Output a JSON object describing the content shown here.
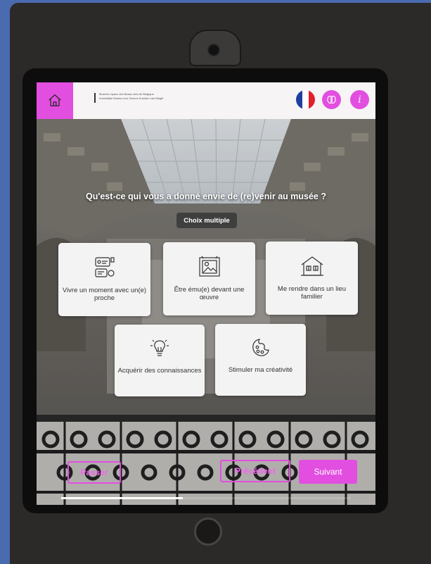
{
  "header": {
    "logo_line1": "Musées royaux des Beaux-Arts de Belgique",
    "logo_line2": "Koninklijke Musea voor Schone Kunsten van België"
  },
  "question": "Qu'est-ce qui vous a donné envie de (re)venir au musée ?",
  "badge": "Choix multiple",
  "options": [
    {
      "label": "Vivre un moment avec un(e) proche",
      "icon": "chat-bubbles-icon"
    },
    {
      "label": "Être ému(e) devant une œuvre",
      "icon": "framed-painting-icon"
    },
    {
      "label": "Me rendre dans un lieu familier",
      "icon": "house-icon"
    },
    {
      "label": "Acquérir des connaissances",
      "icon": "lightbulb-icon"
    },
    {
      "label": "Stimuler ma créativité",
      "icon": "palette-icon"
    }
  ],
  "footer": {
    "skip": "Passer",
    "previous": "Précédent",
    "next": "Suivant"
  },
  "progress": 0.42,
  "colors": {
    "accent": "#e24ee0",
    "flag_blue": "#1f3fa0",
    "flag_white": "#ffffff",
    "flag_red": "#e0212b"
  }
}
